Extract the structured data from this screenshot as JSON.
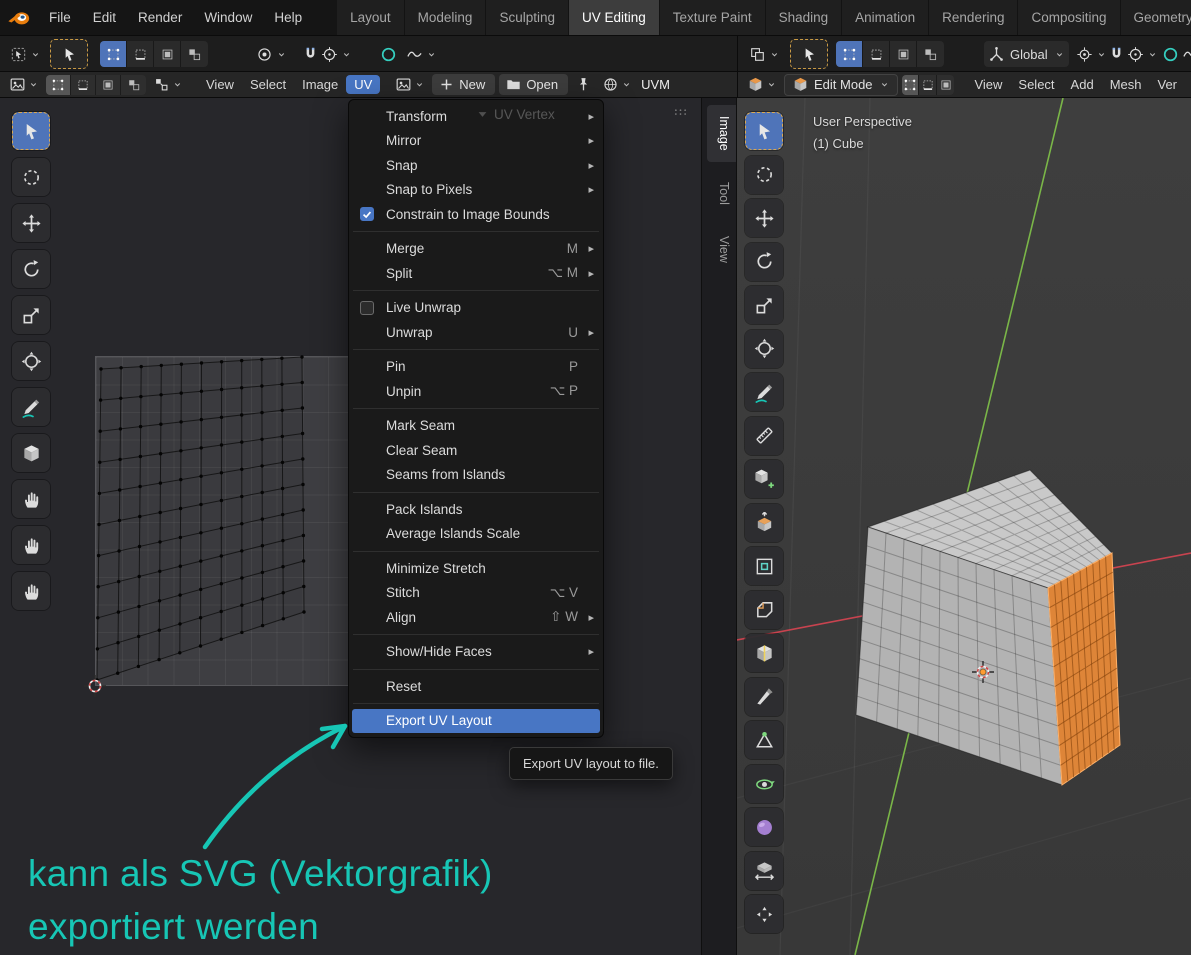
{
  "topbar": {
    "menus": [
      "File",
      "Edit",
      "Render",
      "Window",
      "Help"
    ],
    "workspace_tabs": [
      "Layout",
      "Modeling",
      "Sculpting",
      "UV Editing",
      "Texture Paint",
      "Shading",
      "Animation",
      "Rendering",
      "Compositing",
      "Geometry N"
    ],
    "active_tab": "UV Editing"
  },
  "tool_settings": {
    "right": {
      "orientation_label": "Global"
    }
  },
  "uv_editor": {
    "header": {
      "menus": [
        "View",
        "Select",
        "Image",
        "UV"
      ],
      "active_menu": "UV",
      "new_label": "New",
      "open_label": "Open",
      "uvmap_label": "UVM"
    },
    "dimmed_selector_label": "UV Vertex",
    "sidebar_tabs": [
      {
        "label": "Image",
        "active": true
      },
      {
        "label": "Tool",
        "active": false
      },
      {
        "label": "View",
        "active": false
      }
    ],
    "toolbar": [
      {
        "name": "tweak-select-tool",
        "icon": "cursor-icon",
        "active": true
      },
      {
        "name": "select-circle-tool",
        "icon": "circle-dashed-icon",
        "active": false
      },
      {
        "name": "move-tool",
        "icon": "move-icon",
        "active": false
      },
      {
        "name": "rotate-tool",
        "icon": "rotate-icon",
        "active": false
      },
      {
        "name": "scale-tool",
        "icon": "scale-icon",
        "active": false
      },
      {
        "name": "transform-tool",
        "icon": "transform-icon",
        "active": false
      },
      {
        "name": "annotate-tool",
        "icon": "pencil-icon",
        "active": false
      },
      {
        "name": "rip-region-tool",
        "icon": "cube-icon",
        "active": false
      },
      {
        "name": "grab-tool",
        "icon": "hand-icon",
        "active": false
      },
      {
        "name": "relax-tool",
        "icon": "hand-icon",
        "active": false
      },
      {
        "name": "pinch-tool",
        "icon": "hand-icon",
        "active": false
      }
    ]
  },
  "uv_menu": {
    "items": [
      {
        "label": "Transform",
        "submenu": true
      },
      {
        "label": "Mirror",
        "submenu": true
      },
      {
        "label": "Snap",
        "submenu": true
      },
      {
        "label": "Snap to Pixels",
        "submenu": true
      },
      {
        "label": "Constrain to Image Bounds",
        "checkbox": "checked"
      },
      {
        "separator": true
      },
      {
        "label": "Merge",
        "shortcut": "M",
        "submenu": true
      },
      {
        "label": "Split",
        "shortcut": "⌥ M",
        "submenu": true
      },
      {
        "separator": true
      },
      {
        "label": "Live Unwrap",
        "checkbox": "unchecked"
      },
      {
        "label": "Unwrap",
        "shortcut": "U",
        "submenu": true
      },
      {
        "separator": true
      },
      {
        "label": "Pin",
        "shortcut": "P"
      },
      {
        "label": "Unpin",
        "shortcut": "⌥ P"
      },
      {
        "separator": true
      },
      {
        "label": "Mark Seam"
      },
      {
        "label": "Clear Seam"
      },
      {
        "label": "Seams from Islands"
      },
      {
        "separator": true
      },
      {
        "label": "Pack Islands"
      },
      {
        "label": "Average Islands Scale"
      },
      {
        "separator": true
      },
      {
        "label": "Minimize Stretch"
      },
      {
        "label": "Stitch",
        "shortcut": "⌥ V"
      },
      {
        "label": "Align",
        "shortcut": "⇧ W",
        "submenu": true
      },
      {
        "separator": true
      },
      {
        "label": "Show/Hide Faces",
        "submenu": true
      },
      {
        "separator": true
      },
      {
        "label": "Reset"
      },
      {
        "separator": true
      },
      {
        "label": "Export UV Layout",
        "highlighted": true
      }
    ]
  },
  "tooltip": "Export UV layout to file.",
  "viewport": {
    "header": {
      "mode_label": "Edit Mode",
      "menus": [
        "View",
        "Select",
        "Add",
        "Mesh",
        "Ver"
      ]
    },
    "overlay_line1": "User Perspective",
    "overlay_line2": "(1) Cube",
    "toolbar": [
      {
        "name": "tweak-select-tool",
        "icon": "cursor-icon",
        "active": true
      },
      {
        "name": "select-circle-tool",
        "icon": "circle-dashed-icon",
        "active": false
      },
      {
        "name": "move-tool",
        "icon": "move-icon",
        "active": false
      },
      {
        "name": "rotate-tool",
        "icon": "rotate-icon",
        "active": false
      },
      {
        "name": "scale-tool",
        "icon": "scale-icon",
        "active": false
      },
      {
        "name": "transform-tool",
        "icon": "transform-icon",
        "active": false
      },
      {
        "name": "annotate-tool",
        "icon": "pencil-icon",
        "active": false
      },
      {
        "name": "measure-tool",
        "icon": "ruler-icon",
        "active": false
      },
      {
        "name": "add-cube-tool",
        "icon": "cube-add-icon",
        "active": false
      },
      {
        "name": "extrude-region-tool",
        "icon": "extrude-icon",
        "active": false
      },
      {
        "name": "inset-faces-tool",
        "icon": "inset-icon",
        "active": false
      },
      {
        "name": "bevel-tool",
        "icon": "bevel-icon",
        "active": false
      },
      {
        "name": "loop-cut-tool",
        "icon": "loop-cut-icon",
        "active": false
      },
      {
        "name": "knife-tool",
        "icon": "knife-icon",
        "active": false
      },
      {
        "name": "poly-build-tool",
        "icon": "poly-build-icon",
        "active": false
      },
      {
        "name": "spin-tool",
        "icon": "spin-icon",
        "active": false
      },
      {
        "name": "smooth-tool",
        "icon": "sphere-icon",
        "active": false
      },
      {
        "name": "edge-slide-tool",
        "icon": "slide-icon",
        "active": false
      },
      {
        "name": "shrink-fatten-tool",
        "icon": "shrink-icon",
        "active": false
      }
    ]
  },
  "annotation": {
    "line1": "kann als SVG (Vektorgrafik)",
    "line2": "exportiert werden",
    "color": "#17c6b5"
  },
  "colors": {
    "accent_blue": "#4876c4",
    "active_tool_blue": "#4f74b9",
    "selected_face_orange": "#de8538",
    "axis_green": "#7ab648",
    "axis_red": "#c8434f",
    "annotate_teal": "#17c6b5"
  }
}
